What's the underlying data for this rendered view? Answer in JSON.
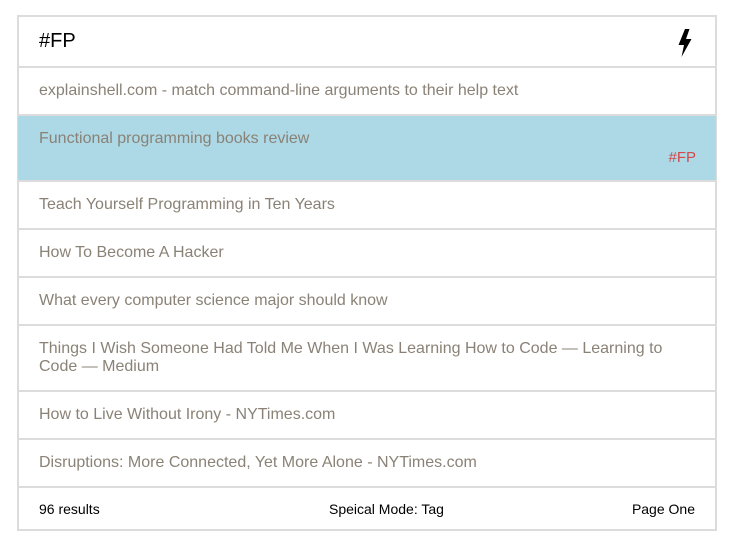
{
  "search": {
    "value": "#FP"
  },
  "icons": {
    "action": "bolt-icon"
  },
  "results": [
    {
      "title": "explainshell.com - match command-line arguments to their help text",
      "tag": ""
    },
    {
      "title": "Functional programming books review",
      "tag": "#FP"
    },
    {
      "title": "Teach Yourself Programming in Ten Years",
      "tag": ""
    },
    {
      "title": "How To Become A Hacker",
      "tag": ""
    },
    {
      "title": "What every computer science major should know",
      "tag": ""
    },
    {
      "title": "Things I Wish Someone Had Told Me When I Was Learning How to Code — Learning to Code — Medium",
      "tag": ""
    },
    {
      "title": "How to Live Without Irony - NYTimes.com",
      "tag": ""
    },
    {
      "title": "Disruptions: More Connected, Yet More Alone - NYTimes.com",
      "tag": ""
    }
  ],
  "selected_index": 1,
  "status": {
    "count": "96 results",
    "mode": "Speical Mode: Tag",
    "page": "Page One"
  },
  "colors": {
    "selected_background": "#add8e6",
    "tag": "#d24a4a",
    "result_text": "#8a8276",
    "border": "#dcdcdc"
  }
}
